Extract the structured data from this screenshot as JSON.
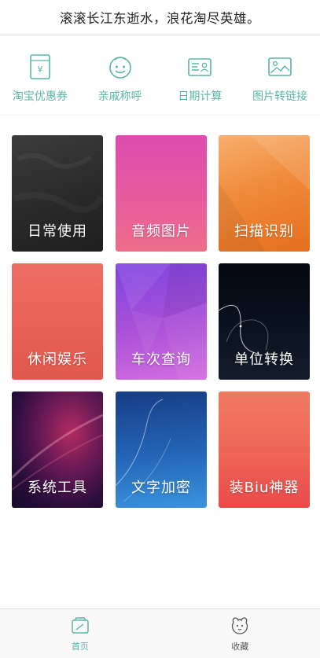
{
  "banner": {
    "text": "滚滚长江东逝水，浪花淘尽英雄。"
  },
  "tools": [
    {
      "label": "淘宝优惠券",
      "icon": "coupon-icon"
    },
    {
      "label": "亲戚称呼",
      "icon": "smiley-face-icon"
    },
    {
      "label": "日期计算",
      "icon": "id-card-icon"
    },
    {
      "label": "图片转链接",
      "icon": "image-icon"
    }
  ],
  "cards": [
    {
      "title": "日常使用"
    },
    {
      "title": "音频图片"
    },
    {
      "title": "扫描识别"
    },
    {
      "title": "休闲娱乐"
    },
    {
      "title": "车次查询"
    },
    {
      "title": "单位转换"
    },
    {
      "title": "系统工具"
    },
    {
      "title": "文字加密"
    },
    {
      "title": "装Biu神器"
    }
  ],
  "tabbar": {
    "home_label": "首页",
    "favorites_label": "收藏"
  },
  "colors": {
    "accent": "#58b6a6"
  }
}
